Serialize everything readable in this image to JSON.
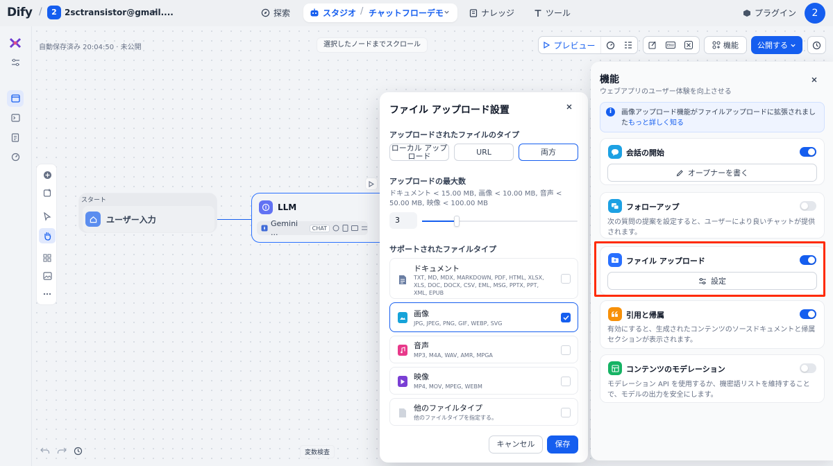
{
  "topbar": {
    "logo": "Dify",
    "workspace_badge": "2",
    "workspace_name": "2sctransistor@gmail....",
    "nav_explore": "探索",
    "nav_studio": "スタジオ",
    "nav_app": "チャットフローデモ",
    "nav_knowledge": "ナレッジ",
    "nav_tools": "ツール",
    "nav_plugins": "プラグイン",
    "avatar": "2"
  },
  "canvas": {
    "autosave": "自動保存済み 20:04:50 · 未公開",
    "scroll_to_node": "選択したノードまでスクロール",
    "variable_inspect": "変数検査",
    "start_node_header": "スタート",
    "start_node_label": "ユーザー入力",
    "llm_title": "LLM",
    "llm_model": "Gemini ...",
    "llm_mode": "CHAT"
  },
  "toolbar": {
    "preview": "プレビュー",
    "features": "機能",
    "publish": "公開する"
  },
  "modal": {
    "title": "ファイル アップロード設置",
    "upload_type_label": "アップロードされたファイルのタイプ",
    "upload_types": [
      "ローカル アップロード",
      "URL",
      "両方"
    ],
    "selected_upload_type": "両方",
    "max_label": "アップロードの最大数",
    "max_desc": "ドキュメント < 15.00 MB, 画像 < 10.00 MB, 音声 < 50.00 MB, 映像 < 100.00 MB",
    "max_value": "3",
    "max_fraction": 0.2,
    "supported_label": "サポートされたファイルタイプ",
    "file_types": [
      {
        "name": "ドキュメント",
        "ext": "TXT, MD, MDX, MARKDOWN, PDF, HTML, XLSX, XLS, DOC, DOCX, CSV, EML, MSG, PPTX, PPT, XML, EPUB",
        "checked": false
      },
      {
        "name": "画像",
        "ext": "JPG, JPEG, PNG, GIF, WEBP, SVG",
        "checked": true
      },
      {
        "name": "音声",
        "ext": "MP3, M4A, WAV, AMR, MPGA",
        "checked": false
      },
      {
        "name": "映像",
        "ext": "MP4, MOV, MPEG, WEBM",
        "checked": false
      },
      {
        "name": "他のファイルタイプ",
        "ext": "他のファイルタイプを指定する。",
        "checked": false
      }
    ],
    "cancel": "キャンセル",
    "save": "保存"
  },
  "panel": {
    "title": "機能",
    "subtitle": "ウェブアプリのユーザー体験を向上させる",
    "info_text": "画像アップロード機能がファイルアップロードに拡張されまし",
    "info_text2": "た",
    "info_link": "もっと詳しく知る",
    "conversation_opener": {
      "title": "会話の開始",
      "enabled": true,
      "button": "オープナーを書く"
    },
    "follow_up": {
      "title": "フォローアップ",
      "enabled": false,
      "desc": "次の質問の提案を設定すると、ユーザーにより良いチャットが提供されます。"
    },
    "file_upload": {
      "title": "ファイル アップロード",
      "enabled": true,
      "button": "設定"
    },
    "citations": {
      "title": "引用と帰属",
      "enabled": true,
      "desc": "有効にすると、生成されたコンテンツのソースドキュメントと帰属セクションが表示されます。"
    },
    "moderation": {
      "title": "コンテンツのモデレーション",
      "enabled": false,
      "desc": "モデレーション API を使用するか、機密語リストを維持することで、モデルの出力を安全にします。"
    }
  },
  "colors": {
    "accent": "#155eef",
    "highlight": "#ff2a00"
  }
}
